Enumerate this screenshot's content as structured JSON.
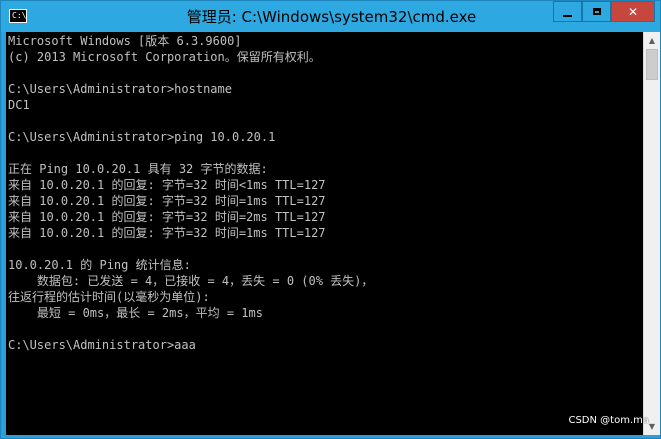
{
  "window": {
    "title": "管理员: C:\\Windows\\system32\\cmd.exe",
    "icon_label": "C:\\",
    "icon": "cmd-window-icon",
    "controls": {
      "minimize_icon": "minimize-icon",
      "maximize_icon": "maximize-icon",
      "close_label": "✕"
    }
  },
  "console": {
    "lines": [
      "Microsoft Windows [版本 6.3.9600]",
      "(c) 2013 Microsoft Corporation。保留所有权利。",
      "",
      "C:\\Users\\Administrator>hostname",
      "DC1",
      "",
      "C:\\Users\\Administrator>ping 10.0.20.1",
      "",
      "正在 Ping 10.0.20.1 具有 32 字节的数据:",
      "来自 10.0.20.1 的回复: 字节=32 时间<1ms TTL=127",
      "来自 10.0.20.1 的回复: 字节=32 时间=1ms TTL=127",
      "来自 10.0.20.1 的回复: 字节=32 时间=2ms TTL=127",
      "来自 10.0.20.1 的回复: 字节=32 时间=1ms TTL=127",
      "",
      "10.0.20.1 的 Ping 统计信息:",
      "    数据包: 已发送 = 4，已接收 = 4，丢失 = 0 (0% 丢失)，",
      "往返行程的估计时间(以毫秒为单位):",
      "    最短 = 0ms，最长 = 2ms，平均 = 1ms",
      "",
      "C:\\Users\\Administrator>aaa"
    ]
  },
  "scrollbar": {
    "up_arrow": "▲",
    "down_arrow": "▼"
  },
  "watermark": "CSDN @tom.ma",
  "colors": {
    "title_bar": "#2ea8e0",
    "console_background": "#000000",
    "console_text": "#c0c0c0",
    "close_button": "#c7463e"
  }
}
